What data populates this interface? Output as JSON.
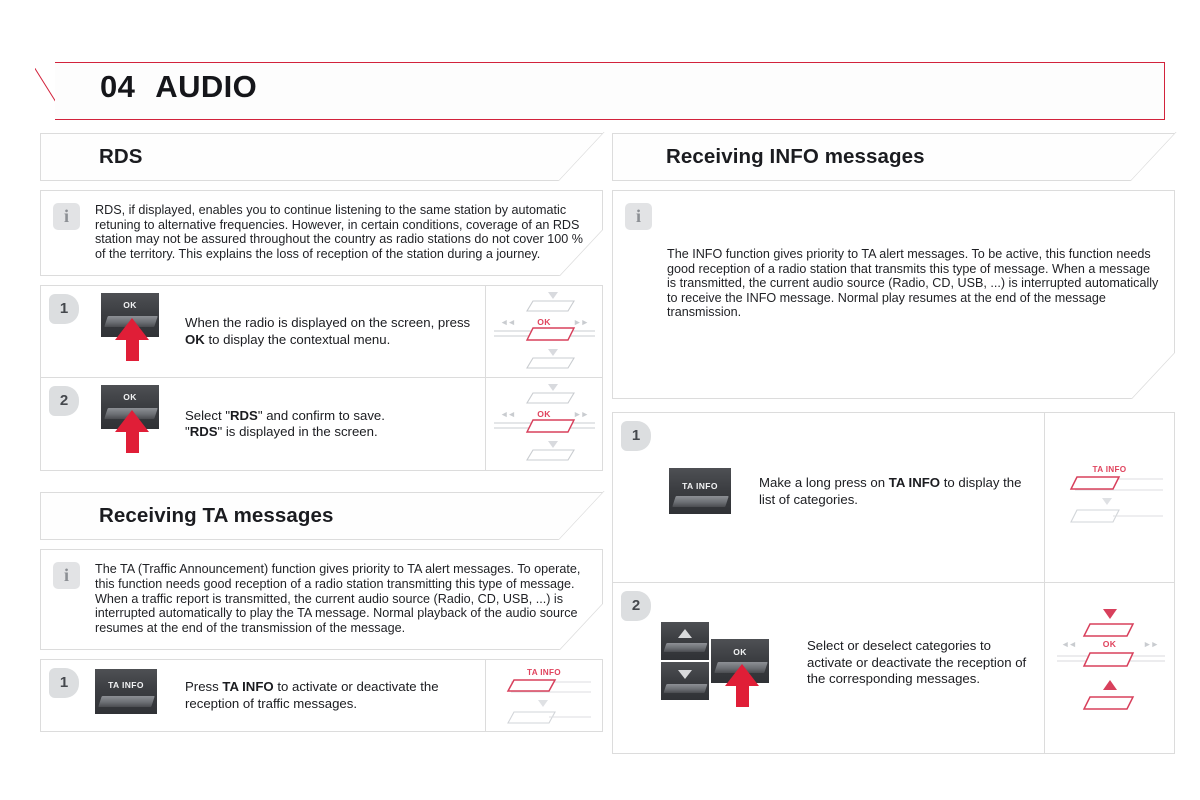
{
  "chapter": {
    "number": "04",
    "title": "AUDIO",
    "accent_color": "#d2233c"
  },
  "left_column": {
    "section_rds": {
      "heading": "RDS",
      "info": {
        "icon": "info-icon",
        "text": "RDS, if displayed, enables you to continue listening to the same station by automatic retuning to alternative frequencies. However, in certain conditions, coverage of an RDS station may not be assured throughout the country as radio stations do not cover 100 % of the territory. This explains the loss of reception of the station during a journey."
      },
      "steps": [
        {
          "number": "1",
          "button_label": "OK",
          "text_parts": [
            {
              "t": "When the radio is displayed on the screen, press ",
              "b": false
            },
            {
              "t": "OK",
              "b": true
            },
            {
              "t": " to display the contextual menu.",
              "b": false
            }
          ],
          "diagram": "ok-rocker-pad"
        },
        {
          "number": "2",
          "button_label": "OK",
          "text_parts": [
            {
              "t": "Select \"",
              "b": false
            },
            {
              "t": "RDS",
              "b": true
            },
            {
              "t": "\" and confirm to save.",
              "b": false
            },
            {
              "t": "\n",
              "b": false
            },
            {
              "t": "\"",
              "b": false
            },
            {
              "t": "RDS",
              "b": true
            },
            {
              "t": "\" is displayed in the screen.",
              "b": false
            }
          ],
          "diagram": "ok-rocker-pad"
        }
      ]
    },
    "section_ta": {
      "heading": "Receiving TA messages",
      "info": {
        "icon": "info-icon",
        "text": "The TA (Traffic Announcement) function gives priority to TA alert messages. To operate, this function needs good reception of a radio station transmitting this type of message. When a traffic report is transmitted, the current audio source (Radio, CD, USB, ...) is interrupted automatically to play the TA message. Normal playback of the audio source resumes at the end of the transmission of the message."
      },
      "steps": [
        {
          "number": "1",
          "button_label": "TA INFO",
          "text_parts": [
            {
              "t": "Press ",
              "b": false
            },
            {
              "t": "TA INFO",
              "b": true
            },
            {
              "t": " to activate or deactivate the reception of traffic messages.",
              "b": false
            }
          ],
          "diagram": "ta-info-pad",
          "diagram_label": "TA INFO"
        }
      ]
    }
  },
  "right_column": {
    "section_info": {
      "heading": "Receiving INFO messages",
      "info": {
        "icon": "info-icon",
        "text": "The INFO function gives priority to TA alert messages. To be active, this function needs good reception of a radio station that transmits this type of message. When a message is transmitted, the current audio source (Radio, CD, USB, ...) is interrupted automatically to receive the INFO message. Normal play resumes at the end of the message transmission."
      },
      "steps": [
        {
          "number": "1",
          "button_label": "TA INFO",
          "text_parts": [
            {
              "t": "Make a long press on ",
              "b": false
            },
            {
              "t": "TA INFO",
              "b": true
            },
            {
              "t": " to display the list of categories.",
              "b": false
            }
          ],
          "diagram": "ta-info-pad",
          "diagram_label": "TA INFO"
        },
        {
          "number": "2",
          "button_label": "OK",
          "text_parts": [
            {
              "t": "Select or deselect categories to activate or deactivate the reception of the corresponding messages.",
              "b": false
            }
          ],
          "diagram": "updown-ok-pad",
          "diagram_label": "OK"
        }
      ]
    }
  },
  "diagram_labels": {
    "ok": "OK",
    "ta_info": "TA INFO",
    "seek_back": "◄◄",
    "seek_fwd": "►►"
  }
}
